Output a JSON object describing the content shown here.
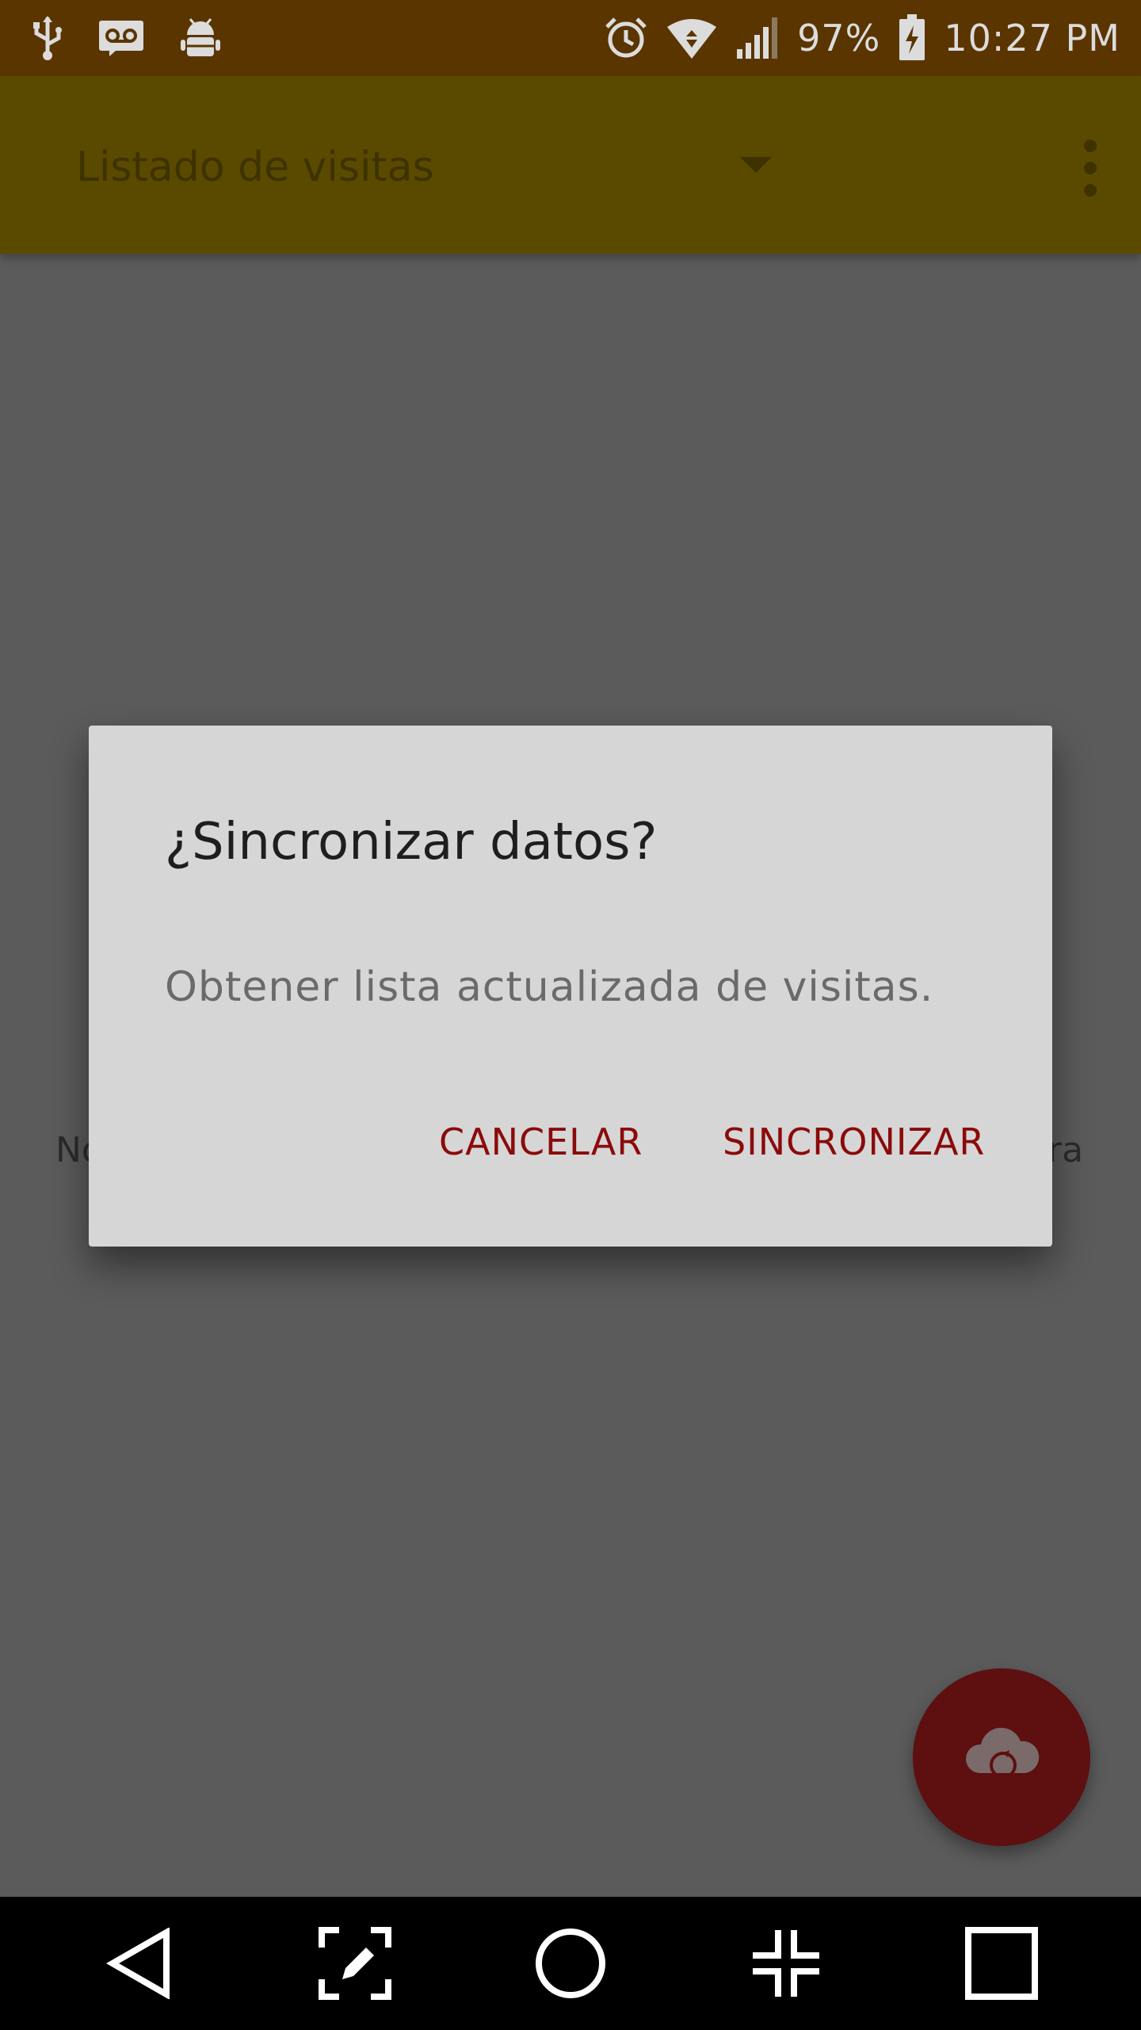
{
  "status_bar": {
    "battery": "97%",
    "time": "10:27 PM",
    "left_icons": [
      "usb-icon",
      "voicemail-icon",
      "android-debug-icon"
    ],
    "right_icons": [
      "alarm-icon",
      "wifi-icon",
      "signal-icon",
      "battery-charging-icon"
    ]
  },
  "app_bar": {
    "spinner_title": "Listado de visitas",
    "background_color": "#5a4a00"
  },
  "background_content": {
    "left_fragment": "No",
    "right_fragment": "ra"
  },
  "dialog": {
    "title": "¿Sincronizar datos?",
    "message": "Obtener lista actualizada de visitas.",
    "cancel_label": "CANCELAR",
    "confirm_label": "SINCRONIZAR",
    "button_color": "#8b0a0a"
  },
  "fab": {
    "icon": "cloud-sync-icon",
    "color": "#5e0f0f"
  },
  "nav_bar": {
    "buttons": [
      "back-icon",
      "capture-icon",
      "home-icon",
      "dual-window-icon",
      "recents-icon"
    ]
  }
}
